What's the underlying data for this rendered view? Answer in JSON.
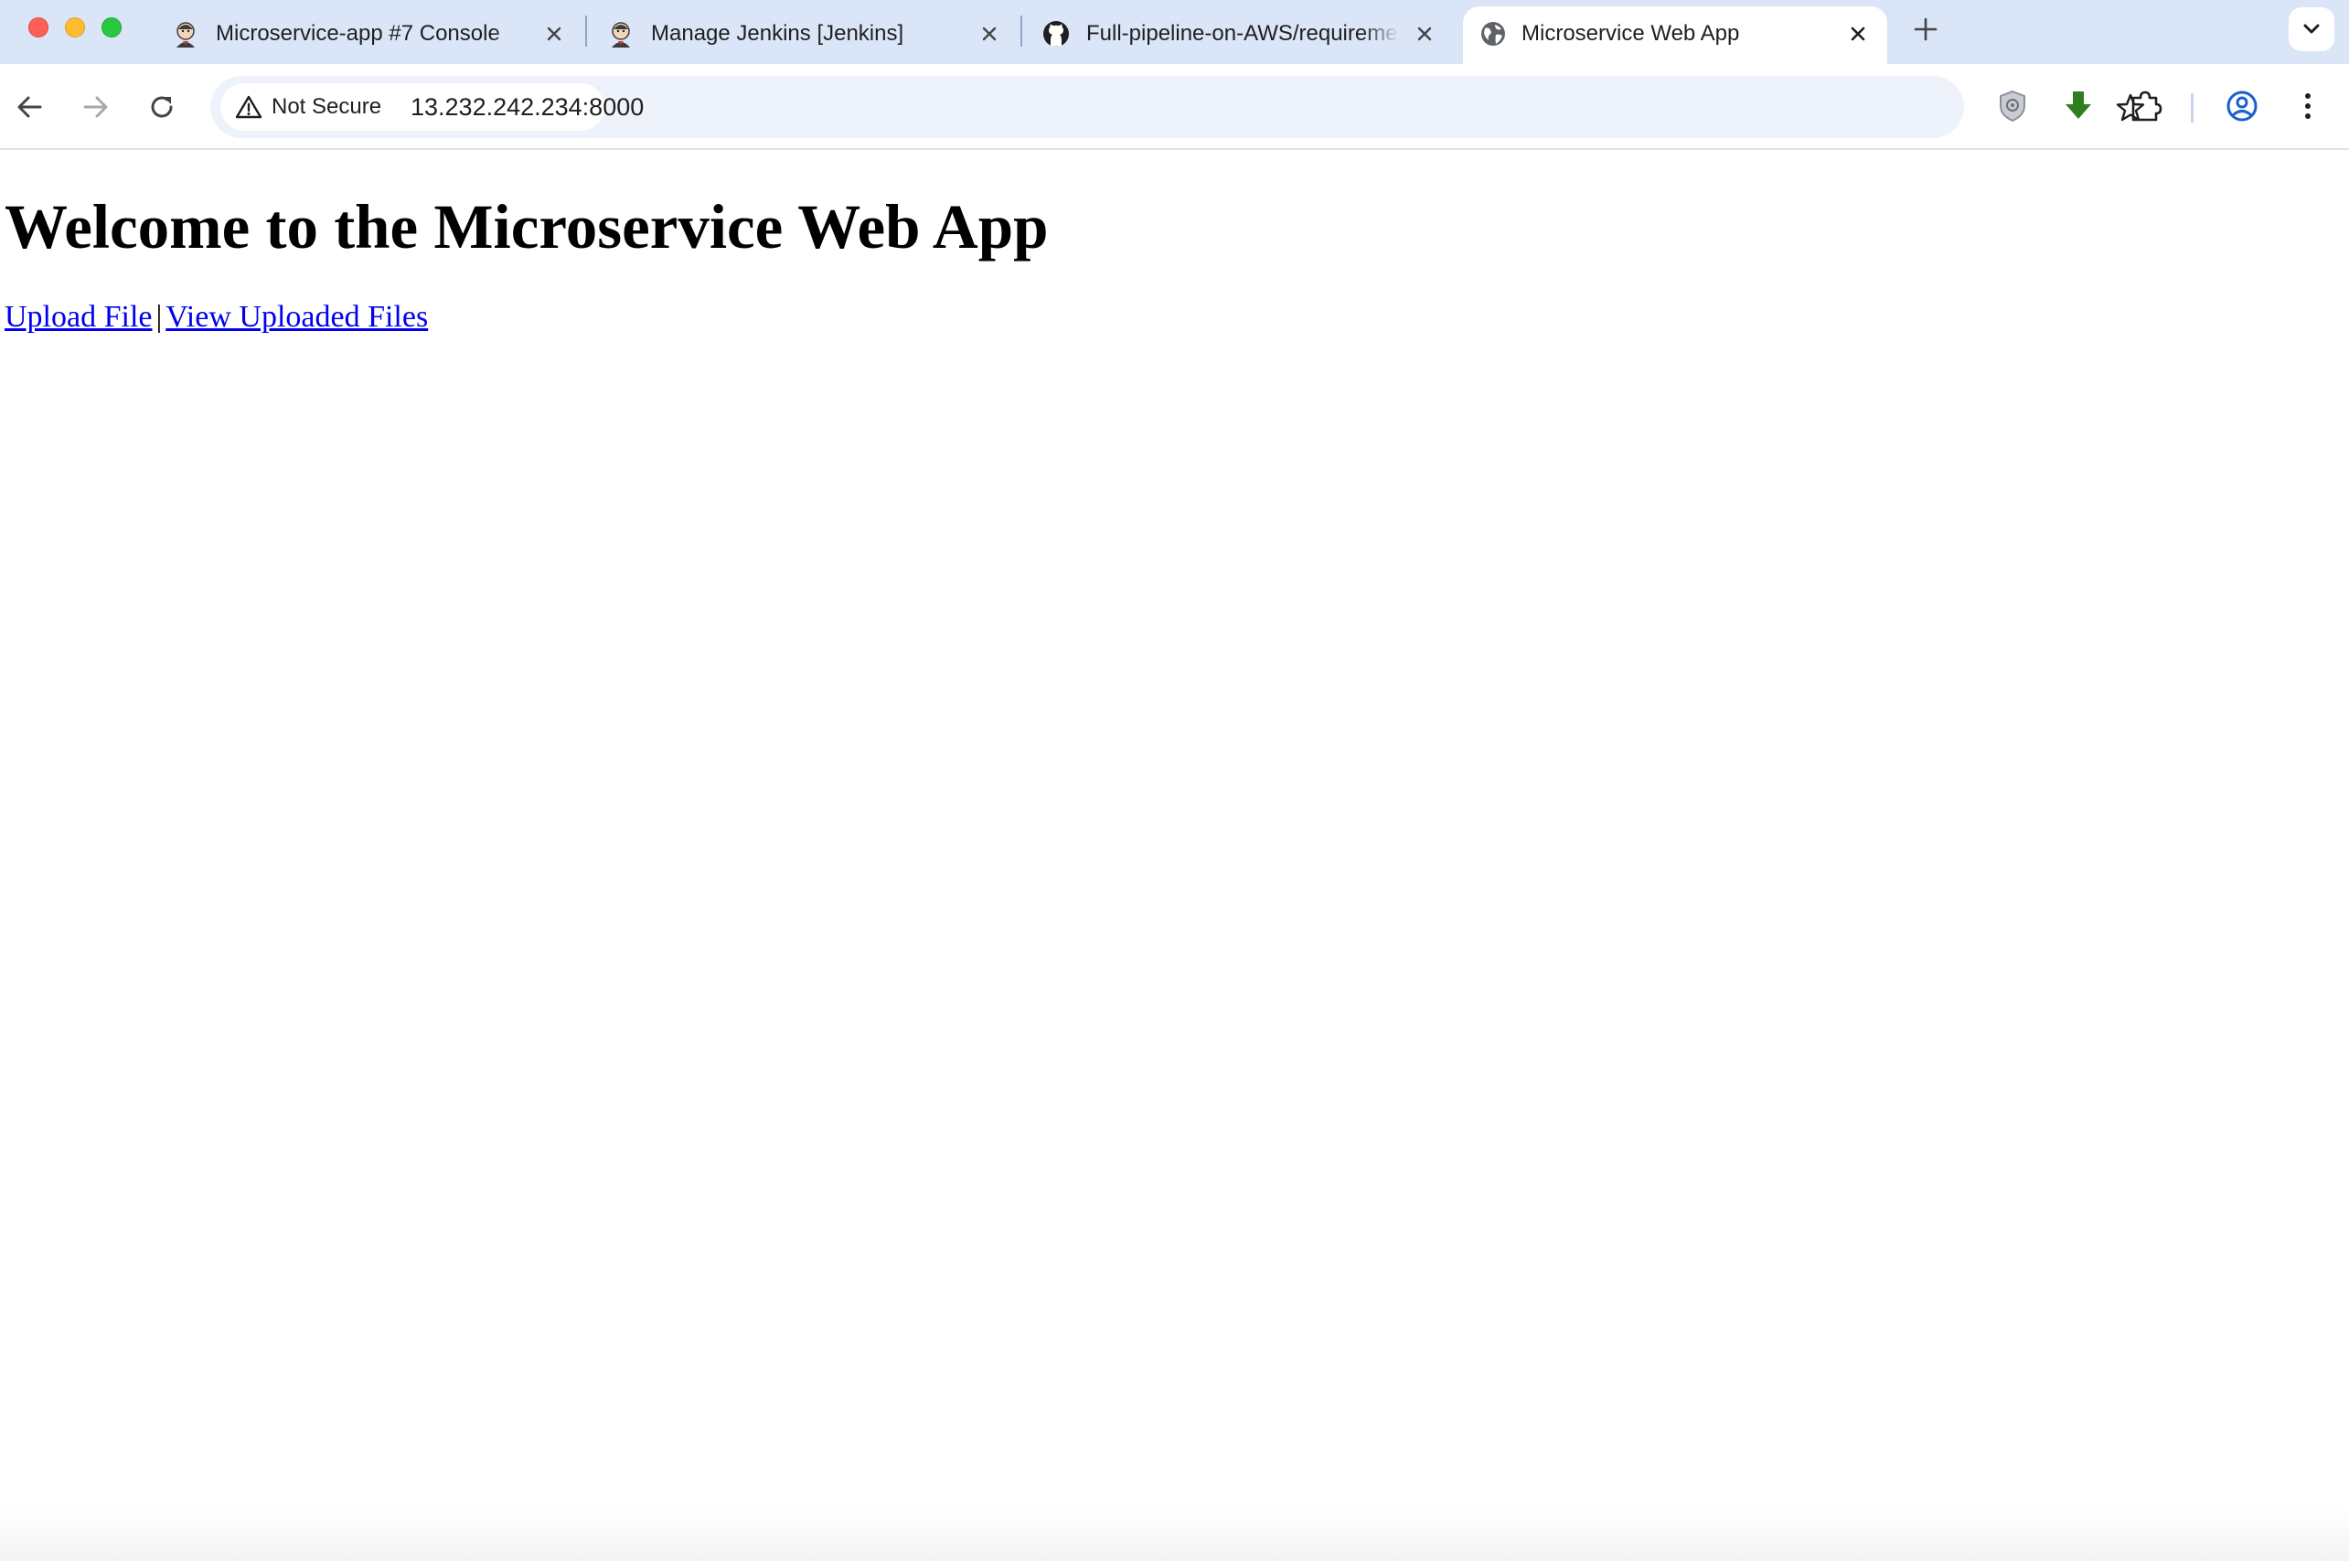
{
  "tabs": [
    {
      "title": "Microservice-app #7 Console",
      "favicon": "jenkins-icon",
      "active": false
    },
    {
      "title": "Manage Jenkins [Jenkins]",
      "favicon": "jenkins-icon",
      "active": false
    },
    {
      "title": "Full-pipeline-on-AWS/requirements",
      "favicon": "github-icon",
      "active": false
    },
    {
      "title": "Microservice Web App",
      "favicon": "globe-icon",
      "active": true
    }
  ],
  "toolbar": {
    "security_label": "Not Secure",
    "url": "13.232.242.234:8000"
  },
  "icons": {
    "back": "arrow-left-icon",
    "forward": "arrow-right-icon",
    "reload": "reload-icon",
    "security": "warning-triangle-icon",
    "bookmark": "star-icon",
    "extension_shield": "shield-icon",
    "download": "download-icon",
    "extensions": "puzzle-icon",
    "profile": "profile-icon",
    "menu": "kebab-menu-icon",
    "new_tab": "plus-icon",
    "tab_search": "chevron-down-icon"
  },
  "colors": {
    "tabstrip_bg": "#dbe5f8",
    "omnibox_bg": "#eef2fa",
    "link": "#0000ee",
    "download_icon": "#2e7d1e",
    "profile_icon": "#1a5fd0"
  },
  "page": {
    "heading": "Welcome to the Microservice Web App",
    "links": [
      {
        "label": "Upload File"
      },
      {
        "label": "View Uploaded Files"
      }
    ],
    "separator": "|"
  }
}
